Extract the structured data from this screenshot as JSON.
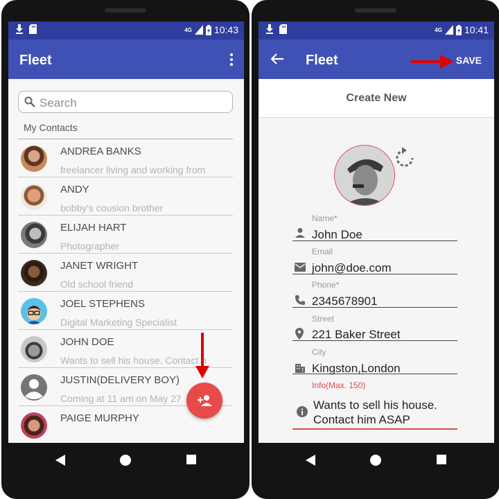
{
  "status": {
    "left": {
      "time": "10:43",
      "network": "4G"
    },
    "right": {
      "time": "10:41",
      "network": "4G"
    }
  },
  "left_screen": {
    "app_title": "Fleet",
    "search": {
      "placeholder": "Search"
    },
    "section_label": "My Contacts",
    "contacts": [
      {
        "name": "ANDREA BANKS",
        "subtitle": "freelancer living and working from"
      },
      {
        "name": "ANDY",
        "subtitle": "bobby's cousion brother"
      },
      {
        "name": "ELIJAH HART",
        "subtitle": "Photographer"
      },
      {
        "name": "JANET WRIGHT",
        "subtitle": "Old school friend"
      },
      {
        "name": "JOEL STEPHENS",
        "subtitle": "Digital Marketing Specialist"
      },
      {
        "name": "JOHN DOE",
        "subtitle": "Wants to sell his house. Contact him"
      },
      {
        "name": "JUSTIN(DELIVERY BOY)",
        "subtitle": "Coming at 11 am on May 27"
      },
      {
        "name": "PAIGE MURPHY",
        "subtitle": ""
      }
    ]
  },
  "right_screen": {
    "app_title": "Fleet",
    "save_label": "SAVE",
    "create_title": "Create New",
    "form": {
      "name": {
        "label": "Name*",
        "value": "John Doe"
      },
      "email": {
        "label": "Email",
        "value": "john@doe.com"
      },
      "phone": {
        "label": "Phone*",
        "value": "2345678901"
      },
      "street": {
        "label": "Street",
        "value": "221 Baker Street"
      },
      "city": {
        "label": "City",
        "value": "Kingston,London"
      },
      "info": {
        "label": "Info(Max. 150)",
        "line1": "Wants to sell his house.",
        "line2": "Contact him ASAP"
      }
    }
  },
  "colors": {
    "primary": "#3f51b5",
    "status_bar": "#2e3d9e",
    "accent": "#e84a4a",
    "annotation_arrow": "#e00000"
  },
  "icons": [
    "download-icon",
    "sd-card-icon",
    "signal-icon",
    "battery-icon",
    "more-vert-icon",
    "search-icon",
    "add-person-icon",
    "back-arrow-icon",
    "refresh-icon",
    "person-icon",
    "email-icon",
    "phone-icon",
    "location-icon",
    "city-icon",
    "info-icon"
  ]
}
